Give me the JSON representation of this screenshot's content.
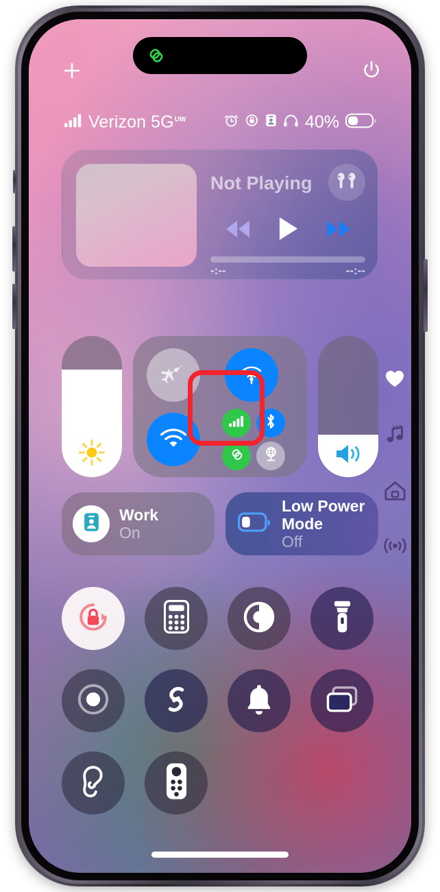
{
  "device": {
    "name": "iPhone",
    "frame_color": "#4a4450"
  },
  "dynamic_island": {
    "icon": "shareplay-rings-icon",
    "icon_color": "#2fd44e"
  },
  "top_controls": {
    "add_label": "+",
    "add_icon": "plus-icon",
    "power_icon": "power-icon"
  },
  "status_bar": {
    "signal_icon": "cellular-bars-icon",
    "carrier": "Verizon 5G",
    "network_superscript": "UW",
    "icons": [
      "alarm-clock-icon",
      "rotation-lock-icon",
      "focus-badge-icon",
      "headphones-icon"
    ],
    "battery_percent": "40%",
    "battery_level": 40
  },
  "media": {
    "title": "Not Playing",
    "artwork": "album-art-placeholder",
    "output_icon": "airpods-icon",
    "rewind_icon": "rewind-icon",
    "play_icon": "play-icon",
    "forward_icon": "fast-forward-icon",
    "elapsed_time": "-:--",
    "remaining_time": "--:--",
    "progress": 0
  },
  "sliders": {
    "brightness": {
      "name": "brightness-slider",
      "icon": "sun-icon",
      "value": 76,
      "icon_color": "#ffcc00"
    },
    "volume": {
      "name": "volume-slider",
      "icon": "speaker-wave-icon",
      "value": 30,
      "icon_color": "#21a3e0"
    }
  },
  "connectivity": {
    "airplane_mode": {
      "label": "airplane-mode",
      "icon": "airplane-icon",
      "active": false
    },
    "airdrop": {
      "label": "airdrop",
      "icon": "airdrop-icon",
      "active": true,
      "color": "#0a84ff"
    },
    "wifi": {
      "label": "wi-fi",
      "icon": "wifi-icon",
      "active": true,
      "color": "#0a84ff"
    },
    "mini": [
      {
        "label": "cellular-data",
        "icon": "cellular-bars-icon",
        "active": true,
        "color": "#2fc84b"
      },
      {
        "label": "bluetooth",
        "icon": "bluetooth-icon",
        "active": true,
        "color": "#0a84ff"
      },
      {
        "label": "personal-hotspot",
        "icon": "hotspot-link-icon",
        "active": true,
        "color": "#2fc84b"
      },
      {
        "label": "vpn",
        "icon": "vpn-globe-icon",
        "active": false,
        "color": "#cdcad7"
      }
    ]
  },
  "annotation": {
    "highlight_color": "#f5232c",
    "target": "connectivity-mini-grid"
  },
  "tiles": {
    "focus": {
      "name": "Work",
      "state": "On",
      "icon": "focus-work-badge-icon",
      "icon_color": "#2aa8bd"
    },
    "low_power": {
      "name": "Low Power Mode",
      "state": "Off",
      "icon": "battery-icon",
      "icon_color": "#4da2ff"
    }
  },
  "controls": {
    "row1": [
      {
        "label": "rotation-lock",
        "icon": "rotation-lock-icon",
        "active": true,
        "style": "white"
      },
      {
        "label": "calculator",
        "icon": "calculator-icon",
        "active": false,
        "style": "dark2"
      },
      {
        "label": "dark-mode",
        "icon": "dark-mode-icon",
        "active": false,
        "style": "dark2"
      },
      {
        "label": "flashlight",
        "icon": "flashlight-icon",
        "active": false,
        "style": "navy"
      }
    ],
    "row2": [
      {
        "label": "screen-record",
        "icon": "screen-record-icon",
        "active": false,
        "style": "dark"
      },
      {
        "label": "shazam",
        "icon": "shazam-icon",
        "active": false,
        "style": "navy"
      },
      {
        "label": "alarm",
        "icon": "bell-icon",
        "active": false,
        "style": "navy"
      },
      {
        "label": "screen-mirroring",
        "icon": "screen-mirroring-icon",
        "active": false,
        "style": "navy"
      }
    ],
    "row3": [
      {
        "label": "hearing",
        "icon": "ear-icon",
        "active": false,
        "style": "dark"
      },
      {
        "label": "apple-tv-remote",
        "icon": "tv-remote-icon",
        "active": false,
        "style": "dark"
      }
    ]
  },
  "edge_pages": [
    {
      "label": "favorites-page",
      "icon": "heart-icon",
      "active": true
    },
    {
      "label": "music-page",
      "icon": "music-note-icon",
      "active": false
    },
    {
      "label": "home-page",
      "icon": "home-icon",
      "active": false
    },
    {
      "label": "connectivity-page",
      "icon": "connectivity-icon",
      "active": false
    }
  ],
  "home_indicator": {
    "label": "home-indicator"
  }
}
